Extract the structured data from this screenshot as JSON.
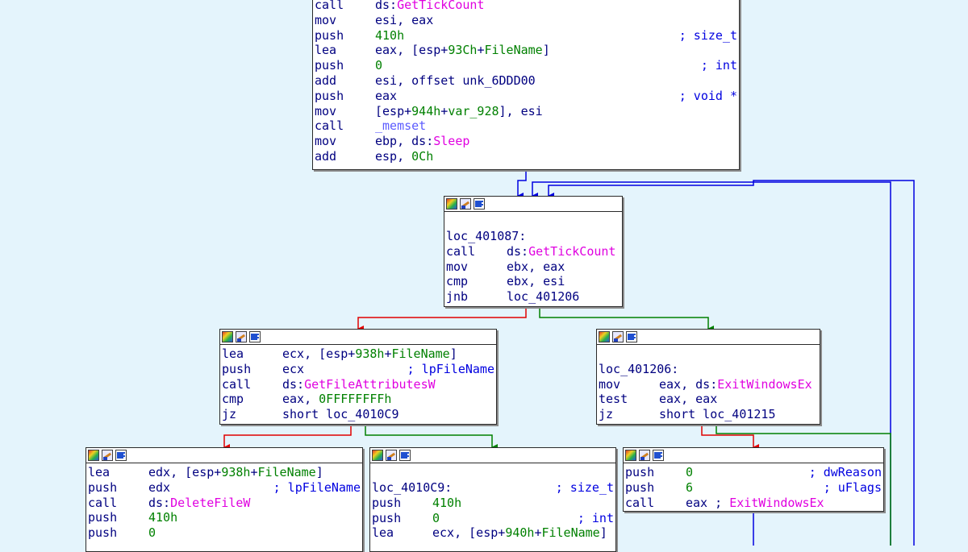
{
  "blocks": {
    "top": {
      "lines": [
        {
          "mnem": "call",
          "ops": [
            {
              "t": "ds:",
              "k": "op"
            },
            {
              "t": "GetTickCount",
              "k": "api"
            }
          ]
        },
        {
          "mnem": "mov",
          "ops": [
            {
              "t": "esi, eax",
              "k": "op"
            }
          ]
        },
        {
          "mnem": "push",
          "ops": [
            {
              "t": "410h",
              "k": "num"
            }
          ],
          "comment": "; size_t"
        },
        {
          "mnem": "lea",
          "ops": [
            {
              "t": "eax, [esp+",
              "k": "op"
            },
            {
              "t": "93Ch",
              "k": "num"
            },
            {
              "t": "+",
              "k": "op"
            },
            {
              "t": "FileName",
              "k": "num"
            },
            {
              "t": "]",
              "k": "op"
            }
          ]
        },
        {
          "mnem": "push",
          "ops": [
            {
              "t": "0",
              "k": "num"
            }
          ],
          "comment": "; int"
        },
        {
          "mnem": "add",
          "ops": [
            {
              "t": "esi, offset unk_6DDD00",
              "k": "op"
            }
          ]
        },
        {
          "mnem": "push",
          "ops": [
            {
              "t": "eax",
              "k": "op"
            }
          ],
          "comment": "; void *"
        },
        {
          "mnem": "mov",
          "ops": [
            {
              "t": "[esp+",
              "k": "op"
            },
            {
              "t": "944h",
              "k": "num"
            },
            {
              "t": "+",
              "k": "op"
            },
            {
              "t": "var_928",
              "k": "num"
            },
            {
              "t": "], esi",
              "k": "op"
            }
          ]
        },
        {
          "mnem": "call",
          "ops": [
            {
              "t": "_memset",
              "k": "lib"
            }
          ]
        },
        {
          "mnem": "mov",
          "ops": [
            {
              "t": "ebp, ds:",
              "k": "op"
            },
            {
              "t": "Sleep",
              "k": "api"
            }
          ]
        },
        {
          "mnem": "add",
          "ops": [
            {
              "t": "esp, ",
              "k": "op"
            },
            {
              "t": "0Ch",
              "k": "num"
            }
          ]
        }
      ]
    },
    "loc_401087": {
      "lines": [
        {
          "label": "loc_401087:"
        },
        {
          "mnem": "call",
          "ops": [
            {
              "t": "ds:",
              "k": "op"
            },
            {
              "t": "GetTickCount",
              "k": "api"
            }
          ]
        },
        {
          "mnem": "mov",
          "ops": [
            {
              "t": "ebx, eax",
              "k": "op"
            }
          ]
        },
        {
          "mnem": "cmp",
          "ops": [
            {
              "t": "ebx, esi",
              "k": "op"
            }
          ]
        },
        {
          "mnem": "jnb",
          "ops": [
            {
              "t": "loc_401206",
              "k": "op"
            }
          ]
        }
      ]
    },
    "getattr": {
      "lines": [
        {
          "mnem": "lea",
          "ops": [
            {
              "t": "ecx, [esp+",
              "k": "op"
            },
            {
              "t": "938h",
              "k": "num"
            },
            {
              "t": "+",
              "k": "op"
            },
            {
              "t": "FileName",
              "k": "num"
            },
            {
              "t": "]",
              "k": "op"
            }
          ]
        },
        {
          "mnem": "push",
          "ops": [
            {
              "t": "ecx",
              "k": "op"
            }
          ],
          "comment": "; lpFileName"
        },
        {
          "mnem": "call",
          "ops": [
            {
              "t": "ds:",
              "k": "op"
            },
            {
              "t": "GetFileAttributesW",
              "k": "api"
            }
          ]
        },
        {
          "mnem": "cmp",
          "ops": [
            {
              "t": "eax, ",
              "k": "op"
            },
            {
              "t": "0FFFFFFFFh",
              "k": "num"
            }
          ]
        },
        {
          "mnem": "jz",
          "ops": [
            {
              "t": "short loc_4010C9",
              "k": "op"
            }
          ]
        }
      ]
    },
    "loc_401206": {
      "lines": [
        {
          "blank": true
        },
        {
          "label": "loc_401206:"
        },
        {
          "mnem": "mov",
          "ops": [
            {
              "t": "eax, ds:",
              "k": "op"
            },
            {
              "t": "ExitWindowsEx",
              "k": "api"
            }
          ]
        },
        {
          "mnem": "test",
          "ops": [
            {
              "t": "eax, eax",
              "k": "op"
            }
          ]
        },
        {
          "mnem": "jz",
          "ops": [
            {
              "t": "short loc_401215",
              "k": "op"
            }
          ]
        }
      ]
    },
    "deletefile": {
      "lines": [
        {
          "mnem": "lea",
          "ops": [
            {
              "t": "edx, [esp+",
              "k": "op"
            },
            {
              "t": "938h",
              "k": "num"
            },
            {
              "t": "+",
              "k": "op"
            },
            {
              "t": "FileName",
              "k": "num"
            },
            {
              "t": "]",
              "k": "op"
            }
          ]
        },
        {
          "mnem": "push",
          "ops": [
            {
              "t": "edx",
              "k": "op"
            }
          ],
          "comment": "; lpFileName"
        },
        {
          "mnem": "call",
          "ops": [
            {
              "t": "ds:",
              "k": "op"
            },
            {
              "t": "DeleteFileW",
              "k": "api"
            }
          ]
        },
        {
          "mnem": "push",
          "ops": [
            {
              "t": "410h",
              "k": "num"
            }
          ]
        },
        {
          "mnem": "push",
          "ops": [
            {
              "t": "0",
              "k": "num"
            }
          ]
        }
      ]
    },
    "loc_4010C9": {
      "lines": [
        {
          "label": "loc_4010C9:",
          "comment": "; size_t"
        },
        {
          "mnem": "push",
          "ops": [
            {
              "t": "410h",
              "k": "num"
            }
          ]
        },
        {
          "mnem": "push",
          "ops": [
            {
              "t": "0",
              "k": "num"
            }
          ],
          "comment": "; int"
        },
        {
          "mnem": "lea",
          "ops": [
            {
              "t": "ecx, [esp+",
              "k": "op"
            },
            {
              "t": "940h",
              "k": "num"
            },
            {
              "t": "+",
              "k": "op"
            },
            {
              "t": "FileName",
              "k": "num"
            },
            {
              "t": "]",
              "k": "op"
            }
          ]
        }
      ]
    },
    "exitwin": {
      "lines": [
        {
          "mnem": "push",
          "ops": [
            {
              "t": "0",
              "k": "num"
            }
          ],
          "comment": "; dwReason"
        },
        {
          "mnem": "push",
          "ops": [
            {
              "t": "6",
              "k": "num"
            }
          ],
          "comment": "; uFlags"
        },
        {
          "mnem": "call",
          "ops": [
            {
              "t": "eax ; ",
              "k": "op"
            },
            {
              "t": "ExitWindowsEx",
              "k": "api"
            }
          ]
        }
      ]
    }
  },
  "colors": {
    "background": "#e4f4fc",
    "edge_unconditional": "#0000e0",
    "edge_true": "#008000",
    "edge_false": "#e00000",
    "mnemonic": "#000080",
    "api": "#e000e0",
    "library": "#5b5bff",
    "number": "#008000",
    "comment": "#0000e0"
  }
}
